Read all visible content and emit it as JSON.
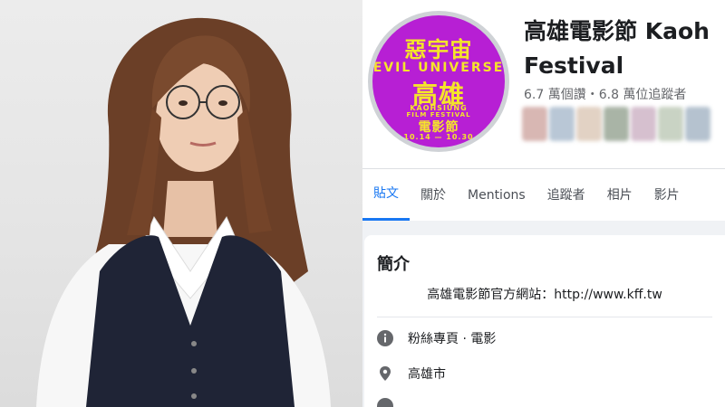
{
  "page": {
    "name_line1": "高雄電影節 Kaoh",
    "name_line2": "Festival",
    "stats": "6.7 萬個讚・6.8 萬位追蹤者"
  },
  "logo": {
    "top_text": "惡宇宙",
    "banner": "EVIL UNIVERSE",
    "city": "高雄",
    "sub_text": "KAOHSIUNG",
    "sub_text2": "FILM FESTIVAL",
    "bottom_text": "電影節",
    "dates": "10.14 — 10.30"
  },
  "tabs": [
    {
      "label": "貼文",
      "active": true
    },
    {
      "label": "關於",
      "active": false
    },
    {
      "label": "Mentions",
      "active": false
    },
    {
      "label": "追蹤者",
      "active": false
    },
    {
      "label": "相片",
      "active": false
    },
    {
      "label": "影片",
      "active": false
    }
  ],
  "intro": {
    "title": "簡介",
    "desc_prefix": "高雄電影節官方網站：",
    "desc_link": "http://www.kff.tw",
    "category": "粉絲專頁 · 電影",
    "location": "高雄市"
  },
  "colors": {
    "accent": "#1877f2",
    "logo_bg": "#b71fd4",
    "logo_text": "#f5e52a"
  }
}
